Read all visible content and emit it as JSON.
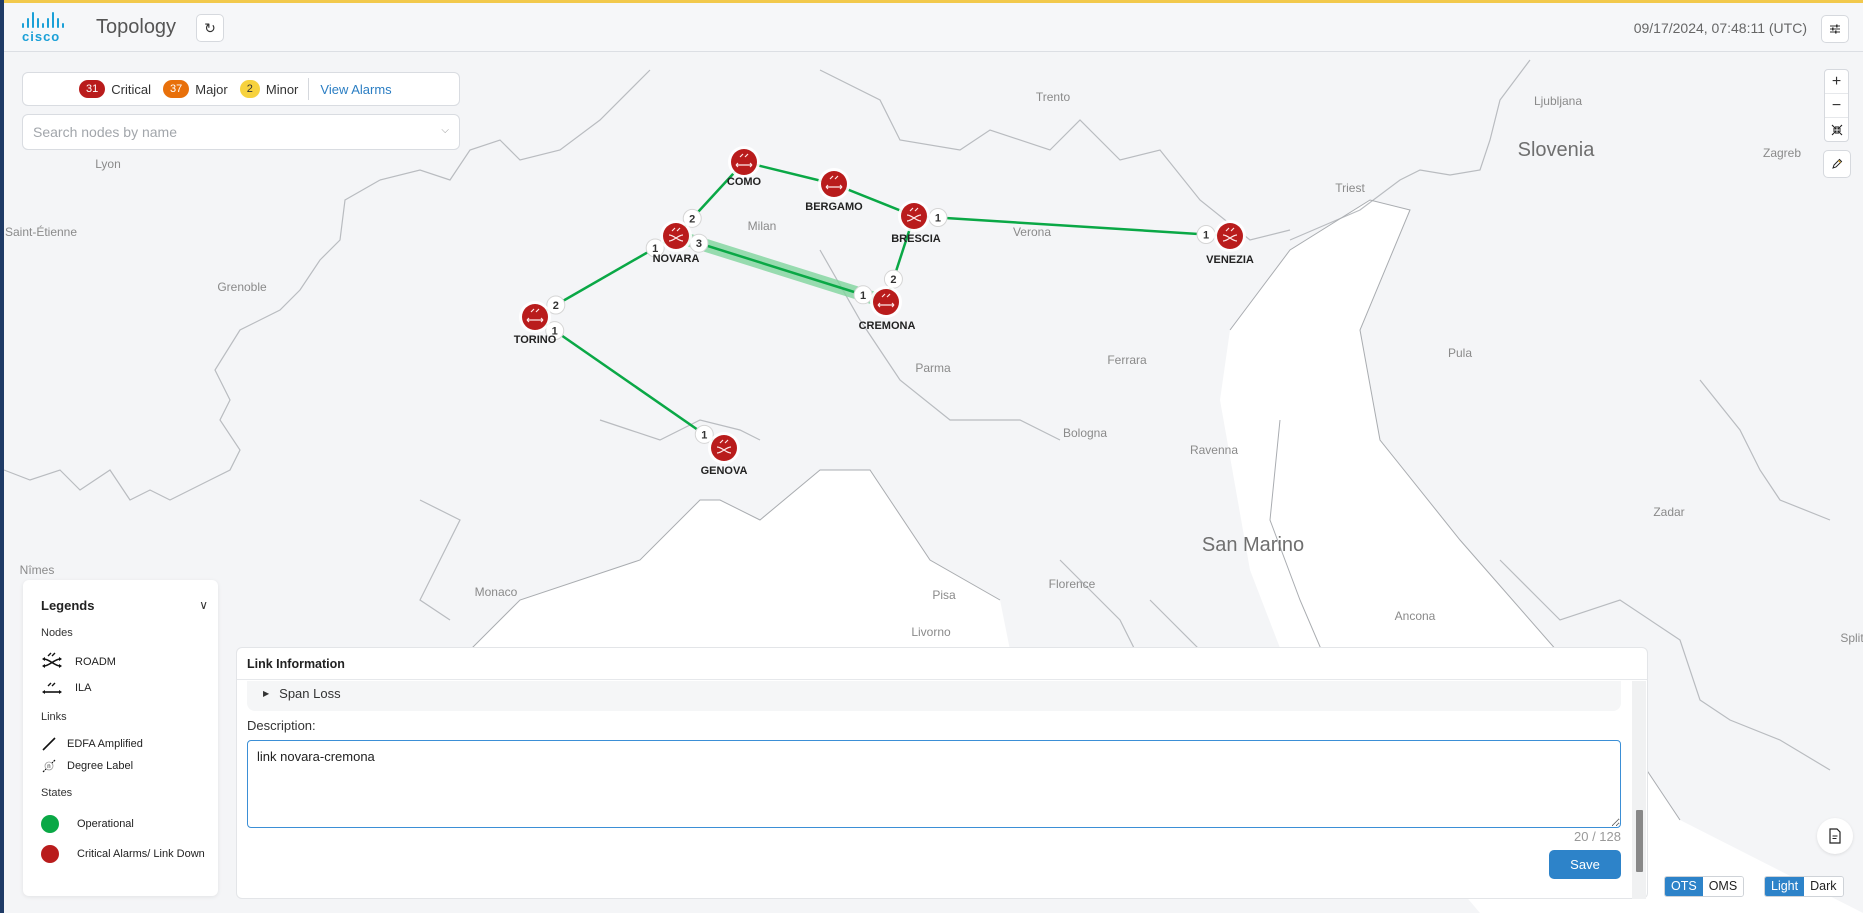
{
  "header": {
    "brand": "cisco",
    "title": "Topology",
    "refresh_icon": "refresh-icon",
    "timestamp": "09/17/2024, 07:48:11 (UTC)",
    "settings_icon": "sliders-icon"
  },
  "alarms": {
    "critical": {
      "count": "31",
      "label": "Critical",
      "color": "#b91c1c"
    },
    "major": {
      "count": "37",
      "label": "Major",
      "color": "#e8700a"
    },
    "minor": {
      "count": "2",
      "label": "Minor",
      "color": "#f7d23e"
    },
    "view_label": "View Alarms"
  },
  "search": {
    "placeholder": "Search nodes by name",
    "value": ""
  },
  "map_controls": {
    "zoom_in": "+",
    "zoom_out": "−",
    "fit": "fit-icon",
    "edit": "pencil-icon"
  },
  "map": {
    "places": [
      "Trento",
      "Ljubljana",
      "Lyon",
      "Saint-Étienne",
      "Grenoble",
      "Milan",
      "Verona",
      "Triest",
      "Zagreb",
      "Parma",
      "Ferrara",
      "Pula",
      "Bologna",
      "Ravenna",
      "Zadar",
      "Nîmes",
      "Monaco",
      "Florence",
      "Pisa",
      "Livorno",
      "Ancona",
      "Split"
    ],
    "countries": [
      "Slovenia",
      "San Marino"
    ],
    "nodes": [
      {
        "id": "como",
        "label": "COMO",
        "type": "ILA",
        "state": "critical"
      },
      {
        "id": "bergamo",
        "label": "BERGAMO",
        "type": "ILA",
        "state": "critical"
      },
      {
        "id": "brescia",
        "label": "BRESCIA",
        "type": "ROADM",
        "state": "critical"
      },
      {
        "id": "novara",
        "label": "NOVARA",
        "type": "ROADM",
        "state": "critical"
      },
      {
        "id": "venezia",
        "label": "VENEZIA",
        "type": "ROADM",
        "state": "critical"
      },
      {
        "id": "torino",
        "label": "TORINO",
        "type": "ILA",
        "state": "critical"
      },
      {
        "id": "cremona",
        "label": "CREMONA",
        "type": "ILA",
        "state": "critical"
      },
      {
        "id": "genova",
        "label": "GENOVA",
        "type": "ROADM",
        "state": "critical"
      }
    ],
    "links": [
      {
        "from": "novara",
        "to": "como",
        "state": "operational",
        "degree_from": "2"
      },
      {
        "from": "como",
        "to": "bergamo",
        "state": "operational"
      },
      {
        "from": "bergamo",
        "to": "brescia",
        "state": "operational"
      },
      {
        "from": "brescia",
        "to": "venezia",
        "state": "operational",
        "degree_from": "1",
        "degree_to": "1"
      },
      {
        "from": "brescia",
        "to": "cremona",
        "state": "operational",
        "degree_to": "2"
      },
      {
        "from": "novara",
        "to": "cremona",
        "state": "operational",
        "selected": true,
        "degree_from": "3",
        "degree_to": "1"
      },
      {
        "from": "novara",
        "to": "torino",
        "state": "operational",
        "degree_from": "1",
        "degree_to": "2"
      },
      {
        "from": "torino",
        "to": "genova",
        "state": "operational",
        "degree_from": "1",
        "degree_to": "1"
      }
    ]
  },
  "legend": {
    "title": "Legends",
    "nodes_heading": "Nodes",
    "nodes": [
      {
        "icon": "roadm-icon",
        "label": "ROADM"
      },
      {
        "icon": "ila-icon",
        "label": "ILA"
      }
    ],
    "links_heading": "Links",
    "links": [
      {
        "icon": "edfa-link-icon",
        "label": "EDFA Amplified"
      },
      {
        "icon": "degree-label-icon",
        "label": "Degree Label"
      }
    ],
    "states_heading": "States",
    "states": [
      {
        "label": "Operational",
        "color": "#0aa846"
      },
      {
        "label": "Critical Alarms/ Link Down",
        "color": "#b91c1c"
      }
    ]
  },
  "link_panel": {
    "title": "Link Information",
    "span_loss_label": "Span Loss",
    "description_label": "Description:",
    "description_value": "link novara-cremona ",
    "counter": "20 / 128",
    "save_label": "Save"
  },
  "view_toggle": {
    "options": [
      "OTS",
      "OMS"
    ],
    "selected": "OTS"
  },
  "theme_toggle": {
    "options": [
      "Light",
      "Dark"
    ],
    "selected": "Light"
  },
  "colors": {
    "accent": "#2d83c9",
    "operational": "#0aa846",
    "critical": "#b91c1c"
  }
}
